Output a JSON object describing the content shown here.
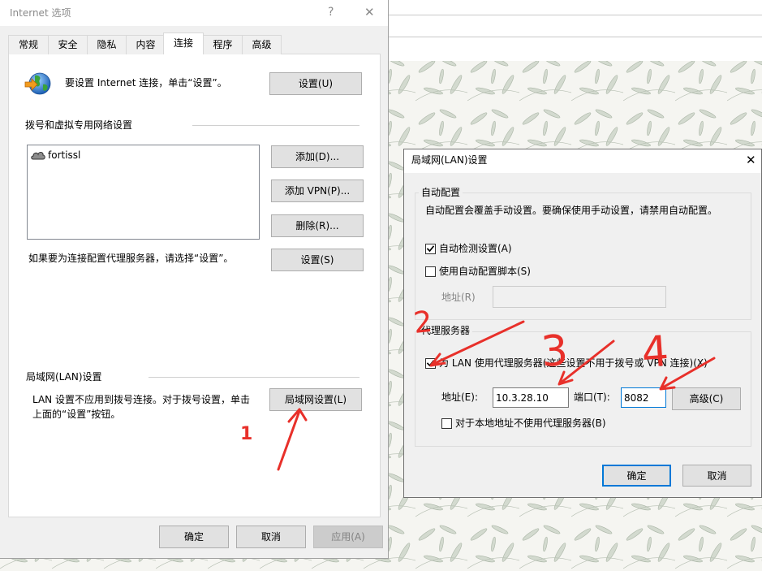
{
  "colors": {
    "window_bg": "#f0f0f0",
    "accent": "#0078d7",
    "annotation": "#e8302a"
  },
  "internet_options": {
    "title": "Internet 选项",
    "help": "?",
    "close": "✕",
    "tabs": [
      {
        "label": "常规",
        "selected": false
      },
      {
        "label": "安全",
        "selected": false
      },
      {
        "label": "隐私",
        "selected": false
      },
      {
        "label": "内容",
        "selected": false
      },
      {
        "label": "连接",
        "selected": true
      },
      {
        "label": "程序",
        "selected": false
      },
      {
        "label": "高级",
        "selected": false
      }
    ],
    "setup": {
      "icon": "internet-globe-icon",
      "text": "要设置 Internet 连接，单击“设置”。",
      "button": "设置(U)"
    },
    "dialup_vpn": {
      "heading": "拨号和虚拟专用网络设置",
      "connections": [
        {
          "name": "fortissl",
          "icon": "vpn-connection-icon"
        }
      ],
      "add_button": "添加(D)...",
      "add_vpn_button": "添加 VPN(P)...",
      "remove_button": "删除(R)...",
      "proxy_hint": "如果要为连接配置代理服务器，请选择“设置”。",
      "settings_button": "设置(S)"
    },
    "lan": {
      "heading": "局域网(LAN)设置",
      "hint_line1": "LAN 设置不应用到拨号连接。对于拨号设置，单击",
      "hint_line2": "上面的“设置”按钮。",
      "button": "局域网设置(L)"
    },
    "footer": {
      "ok": "确定",
      "cancel": "取消",
      "apply": "应用(A)",
      "apply_disabled": true
    }
  },
  "lan_dialog": {
    "title": "局域网(LAN)设置",
    "close": "✕",
    "auto_config": {
      "heading": "自动配置",
      "description": "自动配置会覆盖手动设置。要确保使用手动设置，请禁用自动配置。",
      "auto_detect": {
        "label": "自动检测设置(A)",
        "checked": true
      },
      "use_script": {
        "label": "使用自动配置脚本(S)",
        "checked": false
      },
      "script_address": {
        "label": "地址(R)",
        "value": "",
        "disabled": true
      }
    },
    "proxy": {
      "heading": "代理服务器",
      "use_proxy": {
        "label": "为 LAN 使用代理服务器(这些设置不用于拨号或 VPN 连接)(X)",
        "checked": true
      },
      "address": {
        "label": "地址(E):",
        "value": "10.3.28.10"
      },
      "port": {
        "label": "端口(T):",
        "value": "8082",
        "focused": true
      },
      "advanced_button": "高级(C)",
      "bypass_local": {
        "label": "对于本地地址不使用代理服务器(B)",
        "checked": false
      }
    },
    "ok": "确定",
    "cancel": "取消"
  },
  "annotations": {
    "steps": [
      {
        "label": "1"
      },
      {
        "label": "2"
      },
      {
        "label": "3"
      },
      {
        "label": "4"
      }
    ]
  }
}
